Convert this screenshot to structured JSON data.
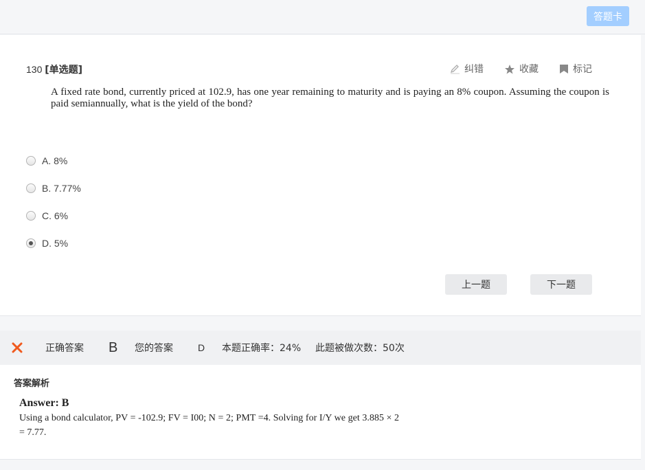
{
  "topbar": {
    "answer_card_label": "答题卡"
  },
  "question": {
    "number": "130",
    "type": "[单选题]",
    "stem": "A fixed rate bond, currently priced at 102.9, has one year remaining to maturity and is paying an 8% coupon. Assuming the coupon is paid semiannually, what is the yield of the bond?",
    "tools": {
      "report": "纠错",
      "favorite": "收藏",
      "mark": "标记"
    },
    "options": [
      {
        "label": "A. 8%",
        "selected": false
      },
      {
        "label": "B. 7.77%",
        "selected": false
      },
      {
        "label": "C. 6%",
        "selected": false
      },
      {
        "label": "D. 5%",
        "selected": true
      }
    ],
    "prev_label": "上一题",
    "next_label": "下一题"
  },
  "result": {
    "correct_answer_label": "正确答案",
    "correct_answer": "B",
    "your_answer_label": "您的答案",
    "your_answer": "D",
    "accuracy": "本题正确率：24%",
    "attempts": "此题被做次数：50次"
  },
  "analysis": {
    "title": "答案解析",
    "answer": "Answer: B",
    "text": "Using a bond calculator, PV = -102.9; FV = I00; N = 2; PMT =4. Solving for I/Y we get 3.885 × 2 = 7.77."
  },
  "colors": {
    "accent_button": "#a3ceff",
    "wrong": "#f05a1e",
    "correct": "#46b749"
  }
}
